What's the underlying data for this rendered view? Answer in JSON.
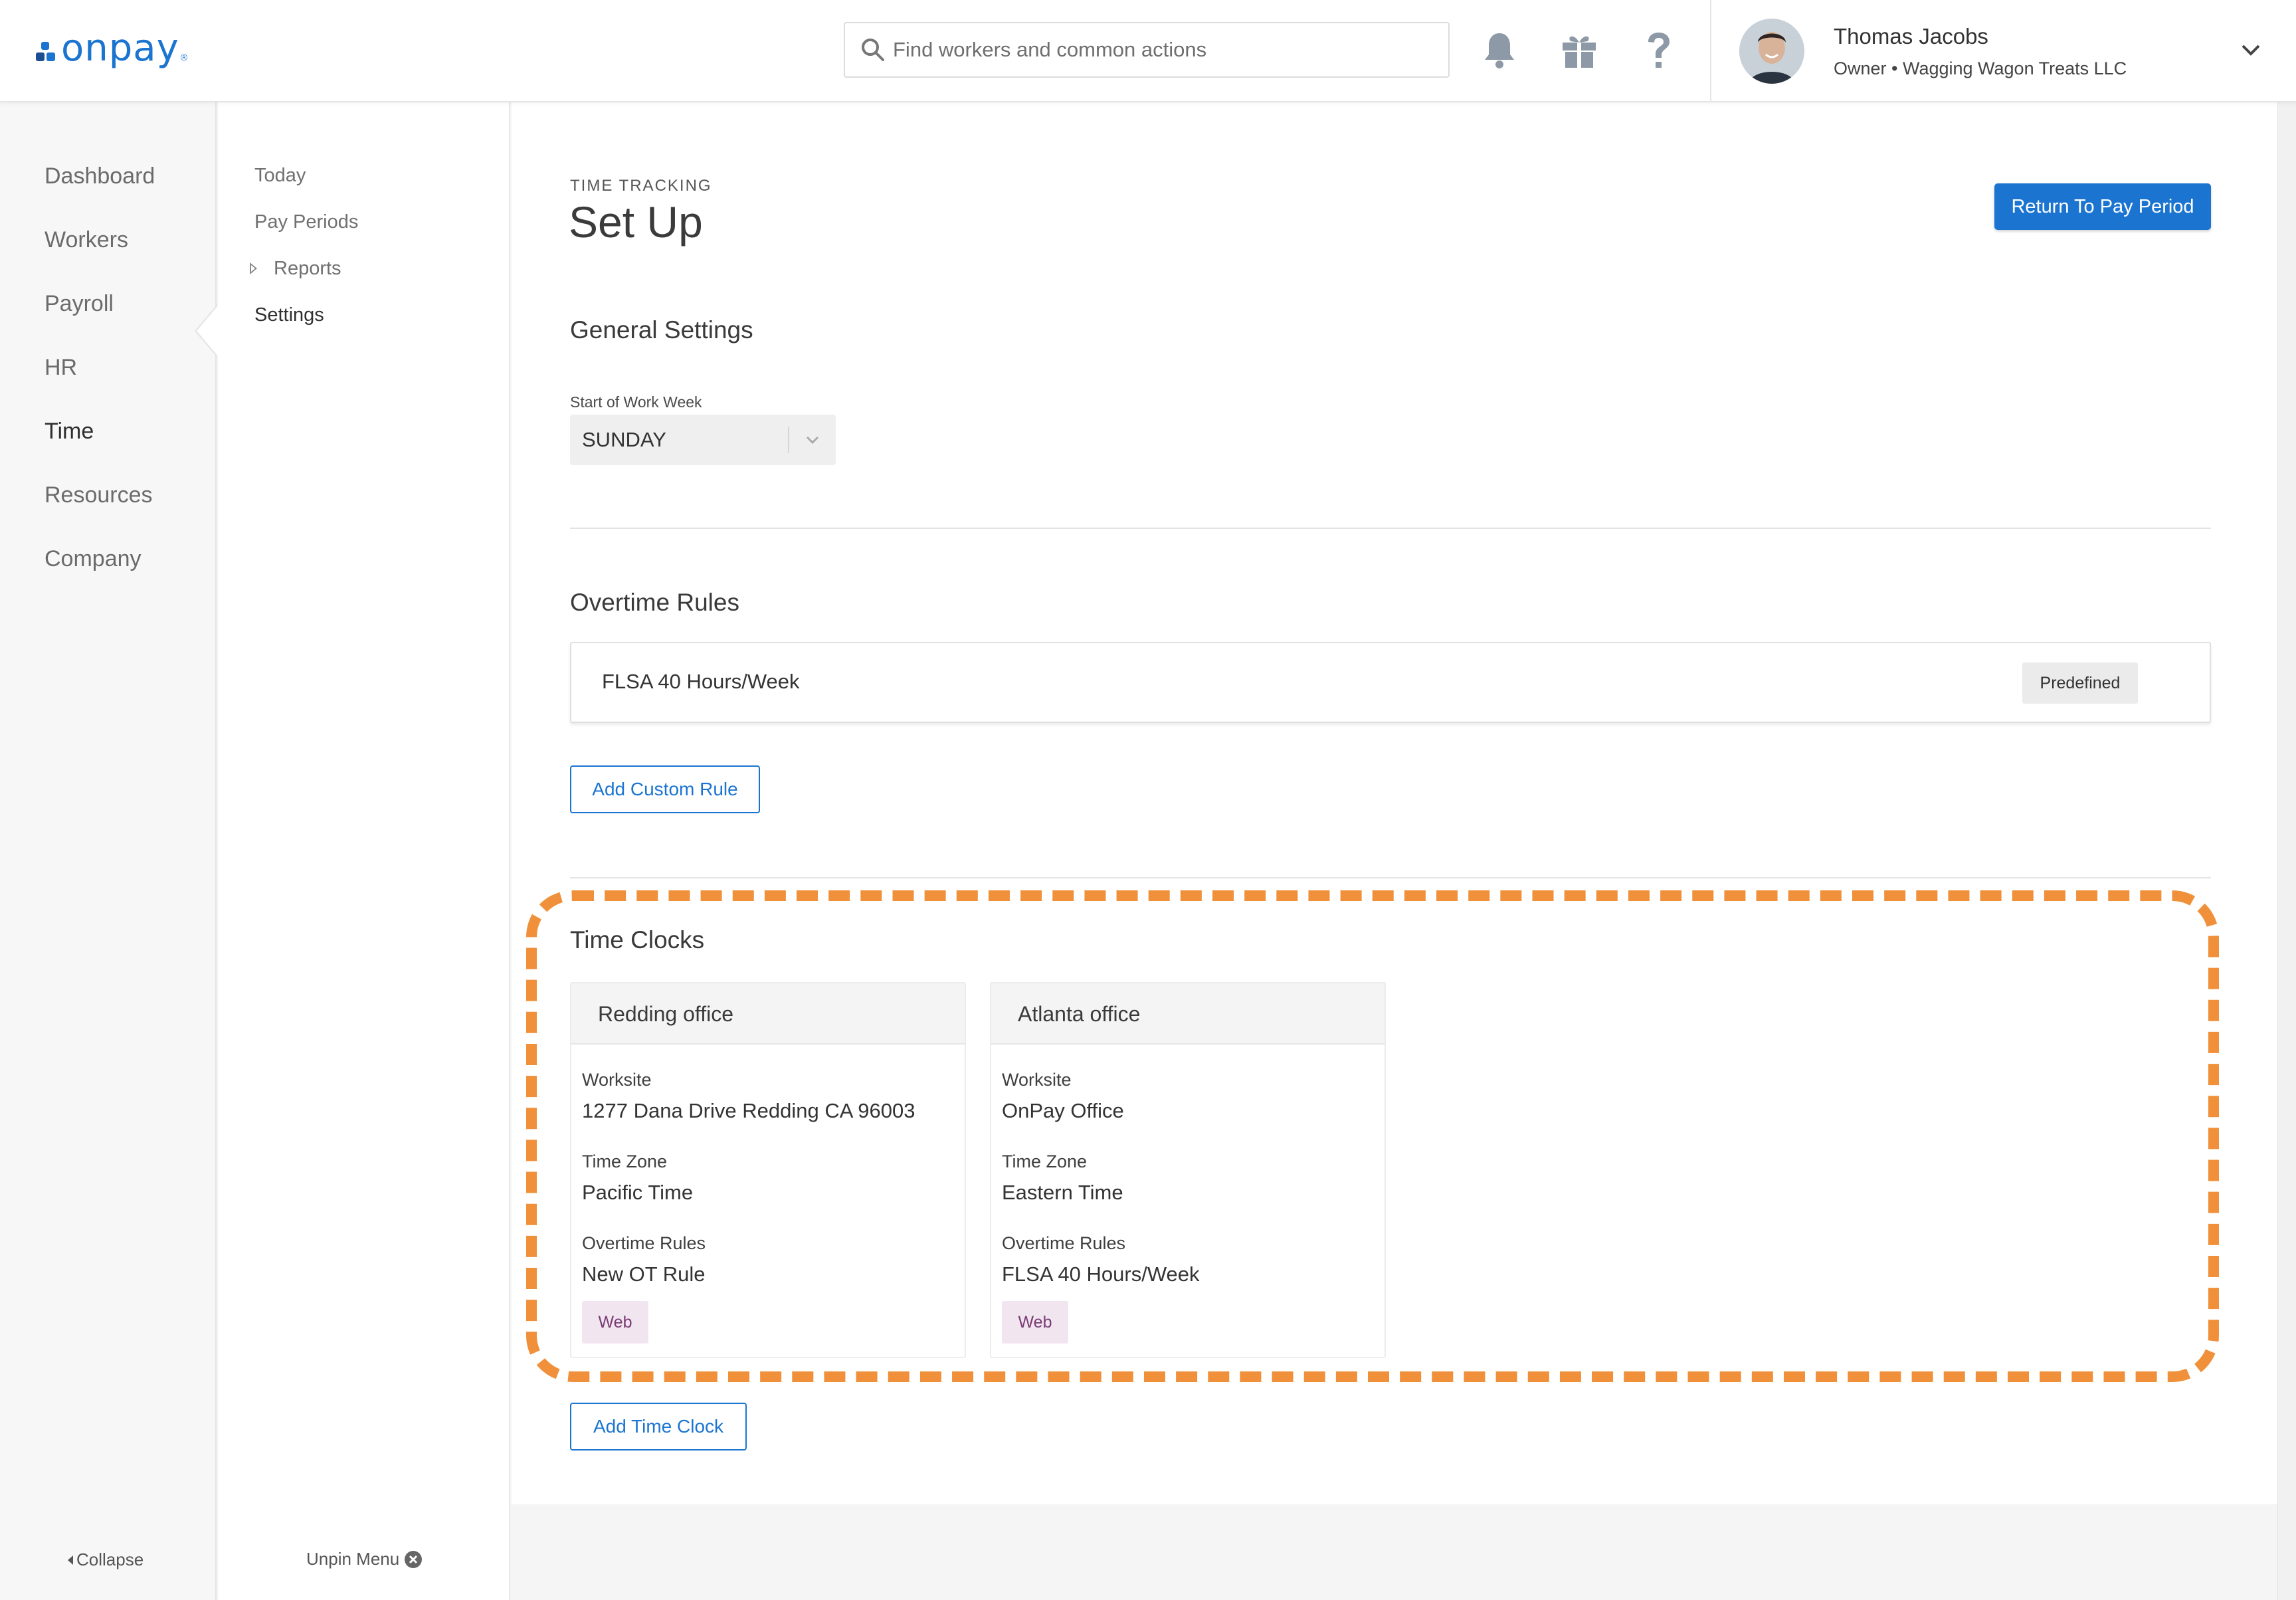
{
  "brand": {
    "name": "onpay",
    "color": "#1b75d0"
  },
  "header": {
    "search_placeholder": "Find workers and common actions",
    "icons": [
      "bell-icon",
      "gift-icon",
      "help-icon"
    ],
    "user": {
      "name": "Thomas Jacobs",
      "role": "Owner • Wagging Wagon Treats LLC"
    }
  },
  "sidebar": {
    "items": [
      {
        "label": "Dashboard"
      },
      {
        "label": "Workers"
      },
      {
        "label": "Payroll"
      },
      {
        "label": "HR"
      },
      {
        "label": "Time",
        "active": true
      },
      {
        "label": "Resources"
      },
      {
        "label": "Company"
      }
    ],
    "collapse_label": "Collapse"
  },
  "subnav": {
    "items": [
      {
        "label": "Today"
      },
      {
        "label": "Pay Periods"
      },
      {
        "label": "Reports",
        "expandable": true
      },
      {
        "label": "Settings",
        "active": true
      }
    ],
    "unpin_label": "Unpin Menu"
  },
  "page": {
    "eyebrow": "TIME TRACKING",
    "title": "Set Up",
    "return_button": "Return To Pay Period"
  },
  "general_settings": {
    "title": "General Settings",
    "start_week_label": "Start of Work Week",
    "start_week_value": "SUNDAY"
  },
  "overtime": {
    "title": "Overtime Rules",
    "rules": [
      {
        "name": "FLSA 40 Hours/Week",
        "badge": "Predefined"
      }
    ],
    "add_button": "Add Custom Rule"
  },
  "time_clocks": {
    "title": "Time Clocks",
    "highlight_color": "#f0903a",
    "labels": {
      "worksite": "Worksite",
      "time_zone": "Time Zone",
      "overtime_rules": "Overtime Rules"
    },
    "clocks": [
      {
        "name": "Redding office",
        "worksite": "1277 Dana Drive Redding CA 96003",
        "time_zone": "Pacific Time",
        "overtime_rules": "New OT Rule",
        "badge": "Web"
      },
      {
        "name": "Atlanta office",
        "worksite": "OnPay Office",
        "time_zone": "Eastern Time",
        "overtime_rules": "FLSA 40 Hours/Week",
        "badge": "Web"
      }
    ],
    "add_button": "Add Time Clock"
  }
}
